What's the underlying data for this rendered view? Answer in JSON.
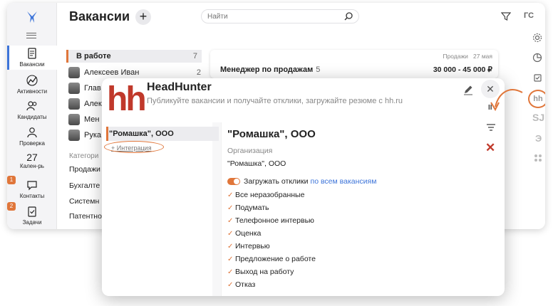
{
  "header": {
    "title": "Вакансии",
    "add_label": "+",
    "search_placeholder": "Найти",
    "gs_label": "ГС"
  },
  "nav": {
    "items": [
      {
        "label": "Вакансии"
      },
      {
        "label": "Активности"
      },
      {
        "label": "Кандидаты"
      },
      {
        "label": "Проверка"
      },
      {
        "label": "Кален-рь",
        "number": "27"
      },
      {
        "label": "Контакты",
        "badge": "1"
      },
      {
        "label": "Задачи",
        "badge": "2"
      }
    ]
  },
  "list": {
    "group": {
      "label": "В работе",
      "count": "7"
    },
    "people": [
      {
        "name": "Алексеев Иван",
        "count": "2"
      },
      {
        "name": "Глав",
        "count": ""
      },
      {
        "name": "Алек",
        "count": ""
      },
      {
        "name": "Мен",
        "count": ""
      },
      {
        "name": "Рука",
        "count": ""
      }
    ],
    "categories_heading": "Категори",
    "categories": [
      "Продажи",
      "Бухгалте",
      "Системн",
      "Патентно"
    ]
  },
  "vacancy": {
    "department": "Продажи",
    "date": "27 мая",
    "title": "Менеджер по продажам",
    "count": "5",
    "salary": "30 000 - 45 000 ₽"
  },
  "rail": {
    "hh": "hh",
    "sj": "SJ",
    "e": "Э"
  },
  "modal": {
    "logo": "hh",
    "title": "HeadHunter",
    "subtitle": "Публикуйте вакансии и получайте отклики, загружайте резюме с hh.ru",
    "org_item": "\"Ромашка\", ООО",
    "integration_link": "Интеграция",
    "panel": {
      "heading": "\"Ромашка\", ООО",
      "org_label": "Организация",
      "org_value": "\"Ромашка\", ООО",
      "toggle_label": "Загружать отклики",
      "toggle_link": "по всем вакансиям",
      "checks": [
        "Все неразобранные",
        "Подумать",
        "Телефонное интервью",
        "Оценка",
        "Интервью",
        "Предложение о работе",
        "Выход на работу",
        "Отказ"
      ]
    },
    "pause_label": "II"
  },
  "colors": {
    "accent": "#e0763a",
    "hh_red": "#c0392b",
    "link_blue": "#3d74d9",
    "active_blue": "#3d74d9"
  }
}
